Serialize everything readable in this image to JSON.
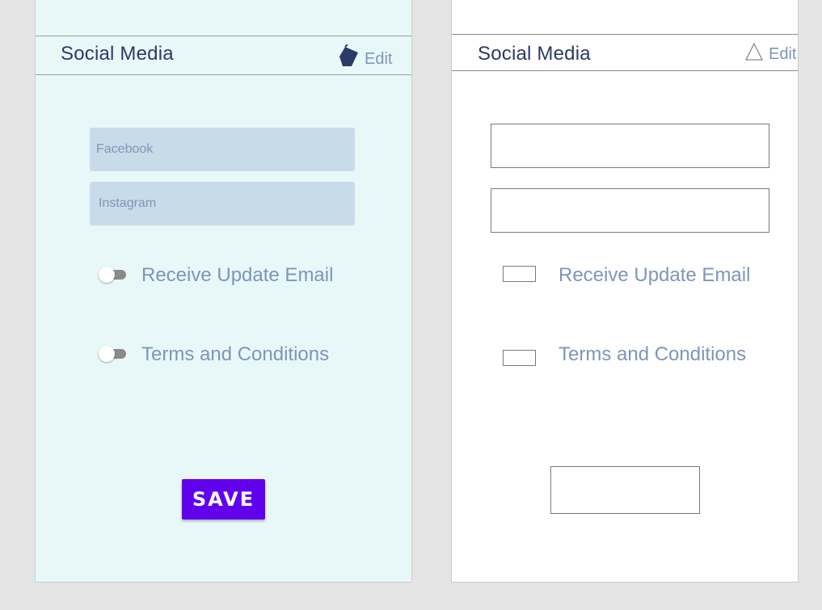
{
  "left_panel": {
    "section_title": "Social Media",
    "edit_label": "Edit",
    "facebook_placeholder": "Facebook",
    "instagram_placeholder": "Instagram",
    "option_email": "Receive Update Email",
    "option_terms": "Terms and Conditions",
    "save_label": "SAVE",
    "edit_icon": "pen-nib-icon"
  },
  "right_panel": {
    "section_title": "Social Media",
    "edit_label": "Edit",
    "option_email": "Receive Update Email",
    "option_terms": "Terms and Conditions",
    "edit_icon": "triangle-icon"
  },
  "colors": {
    "left_background": "#e8f8f8",
    "field_fill": "#c8dbe8",
    "title_text": "#2b3a66",
    "label_text": "#7e95bb",
    "save_button": "#6200ee"
  }
}
